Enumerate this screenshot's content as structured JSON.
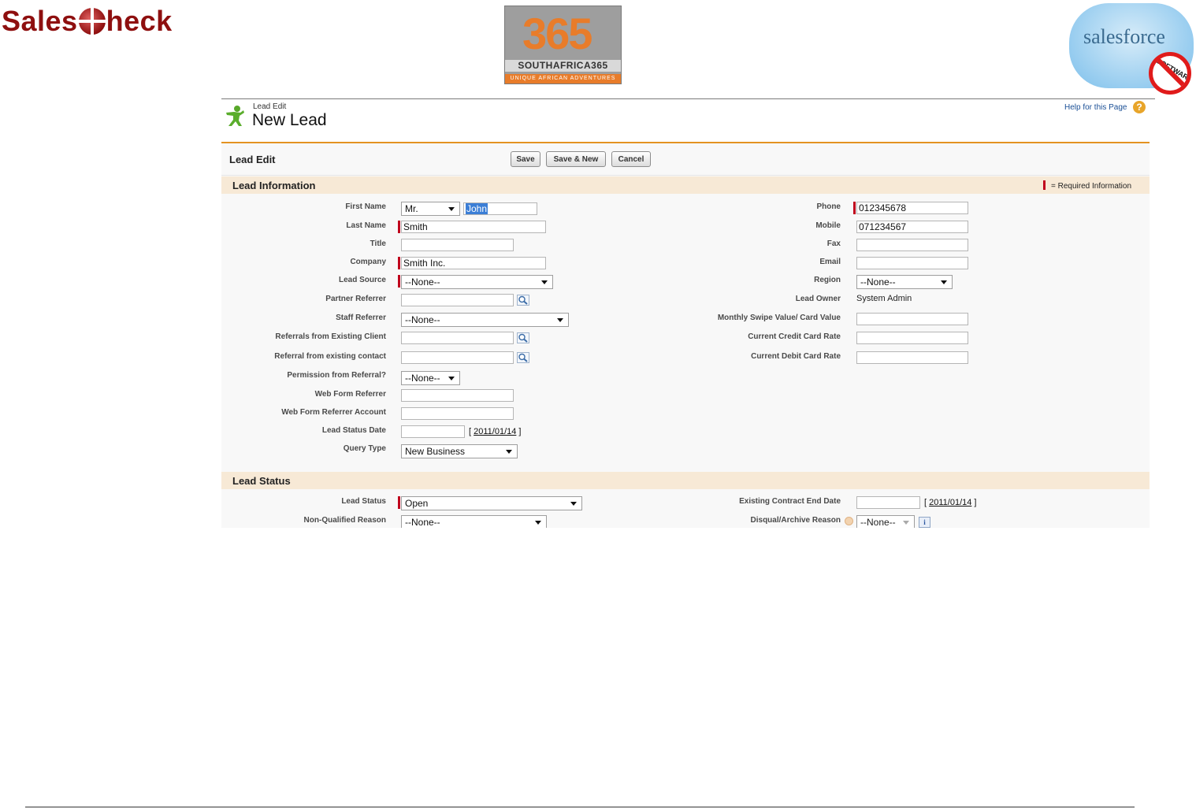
{
  "logos": {
    "saleschk": {
      "part1": "Sales",
      "part2": "heck"
    },
    "southafrica": {
      "number": "365",
      "name": "SOUTHAFRICA365",
      "tagline": "UNIQUE AFRICAN ADVENTURES"
    },
    "salesforce": {
      "word": "salesforce",
      "stamp": "SOFTWARE"
    }
  },
  "header": {
    "breadcrumb": "Lead Edit",
    "title": "New Lead",
    "help_link": "Help for this Page",
    "help_icon": "?"
  },
  "toolbar": {
    "title": "Lead Edit",
    "save_label": "Save",
    "save_new_label": "Save & New",
    "cancel_label": "Cancel"
  },
  "lead_information": {
    "section_title": "Lead Information",
    "required_note": "= Required Information",
    "left": {
      "first_name_label": "First Name",
      "salutation": "Mr.",
      "first_name_value": "John",
      "last_name_label": "Last Name",
      "last_name_value": "Smith",
      "title_label": "Title",
      "title_value": "",
      "company_label": "Company",
      "company_value": "Smith Inc.",
      "lead_source_label": "Lead Source",
      "lead_source_value": "--None--",
      "partner_referrer_label": "Partner Referrer",
      "partner_referrer_value": "",
      "staff_referrer_label": "Staff Referrer",
      "staff_referrer_value": "--None--",
      "referrals_client_label": "Referrals from Existing Client",
      "referrals_client_value": "",
      "referral_contact_label": "Referral from existing contact",
      "referral_contact_value": "",
      "permission_label": "Permission from Referral?",
      "permission_value": "--None--",
      "web_form_referrer_label": "Web Form Referrer",
      "web_form_referrer_value": "",
      "web_form_account_label": "Web Form Referrer Account",
      "web_form_account_value": "",
      "lead_status_date_label": "Lead Status Date",
      "lead_status_date_value": "",
      "lead_status_date_link": "2011/01/14",
      "query_type_label": "Query Type",
      "query_type_value": "New Business"
    },
    "right": {
      "phone_label": "Phone",
      "phone_value": "012345678",
      "mobile_label": "Mobile",
      "mobile_value": "071234567",
      "fax_label": "Fax",
      "fax_value": "",
      "email_label": "Email",
      "email_value": "",
      "region_label": "Region",
      "region_value": "--None--",
      "lead_owner_label": "Lead Owner",
      "lead_owner_value": "System Admin",
      "swipe_label": "Monthly Swipe Value/ Card Value",
      "swipe_value": "",
      "credit_rate_label": "Current Credit Card Rate",
      "credit_rate_value": "",
      "debit_rate_label": "Current Debit Card Rate",
      "debit_rate_value": ""
    }
  },
  "lead_status": {
    "section_title": "Lead Status",
    "lead_status_label": "Lead Status",
    "lead_status_value": "Open",
    "non_qualified_label": "Non-Qualified Reason",
    "non_qualified_value": "--None--",
    "contract_end_label": "Existing Contract End Date",
    "contract_end_value": "",
    "contract_end_link": "2011/01/14",
    "disqual_label": "Disqual/Archive Reason",
    "disqual_value": "--None--",
    "info_icon": "i"
  },
  "colors": {
    "accent_orange": "#e39321",
    "required_red": "#c0001d",
    "section_bg": "#f7e9d6",
    "link_blue": "#1a4f96"
  }
}
